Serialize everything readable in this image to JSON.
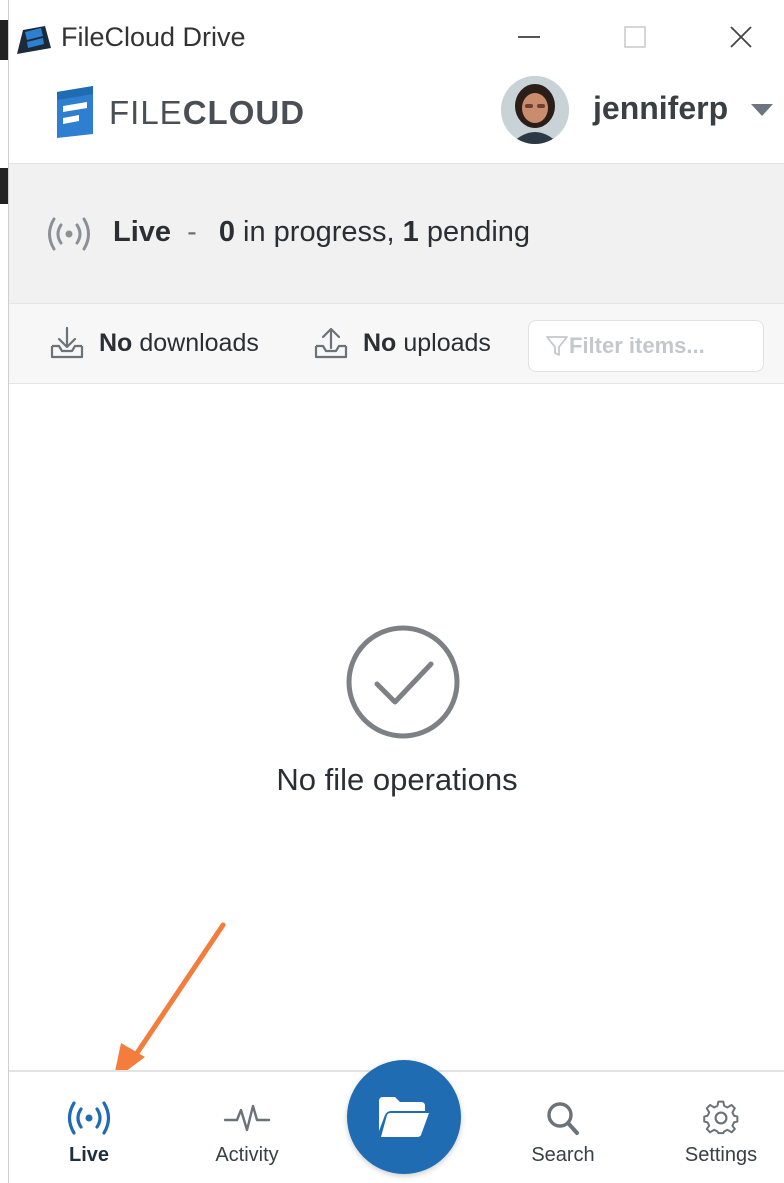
{
  "window": {
    "title": "FileCloud Drive"
  },
  "header": {
    "logo_light": "FILE",
    "logo_bold": "CLOUD",
    "username": "jenniferp"
  },
  "live": {
    "label": "Live",
    "separator": "-",
    "in_progress_count": "0",
    "in_progress_label": "in progress,",
    "pending_count": "1",
    "pending_label": "pending"
  },
  "transfers": {
    "downloads_strong": "No",
    "downloads_label": "downloads",
    "uploads_strong": "No",
    "uploads_label": "uploads",
    "filter_placeholder": "Filter items..."
  },
  "empty_state": {
    "message": "No file operations"
  },
  "bottom_nav": {
    "items": [
      {
        "label": "Live",
        "icon": "broadcast-icon",
        "active": true
      },
      {
        "label": "Activity",
        "icon": "pulse-icon"
      },
      {
        "label": "Search",
        "icon": "search-icon"
      },
      {
        "label": "Settings",
        "icon": "gear-icon"
      }
    ],
    "fab_icon": "folder-open-icon"
  },
  "colors": {
    "brand_blue": "#1f6cb3",
    "annotation_orange": "#f47c3c",
    "live_bar_bg": "#f1f1f1"
  }
}
